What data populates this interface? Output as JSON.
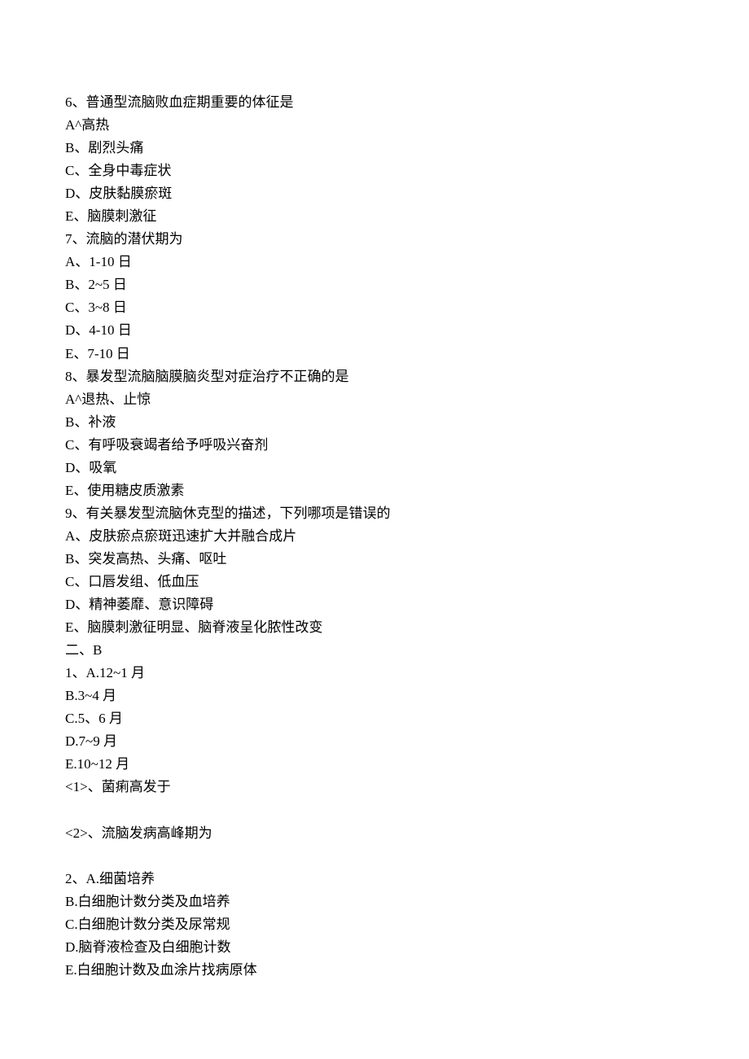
{
  "lines": [
    "6、普通型流脑败血症期重要的体征是",
    "A^高热",
    "B、剧烈头痛",
    "C、全身中毒症状",
    "D、皮肤黏膜瘀斑",
    "E、脑膜刺激征",
    "7、流脑的潜伏期为",
    "A、1-10 日",
    "B、2~5 日",
    "C、3~8 日",
    "D、4-10 日",
    "E、7-10 日",
    "8、暴发型流脑脑膜脑炎型对症治疗不正确的是",
    "A^退热、止惊",
    "B、补液",
    "C、有呼吸衰竭者给予呼吸兴奋剂",
    "D、吸氧",
    "E、使用糖皮质激素",
    "9、有关暴发型流脑休克型的描述，下列哪项是错误的",
    "A、皮肤瘀点瘀斑迅速扩大并融合成片",
    "B、突发高热、头痛、呕吐",
    "C、口唇发组、低血压",
    "D、精神萎靡、意识障碍",
    "E、脑膜刺激征明显、脑脊液呈化脓性改变",
    "二、B",
    "1、A.12~1 月",
    "B.3~4 月",
    "C.5、6 月",
    "D.7~9 月",
    "E.10~12 月",
    "<1>、菌痢高发于",
    "",
    "<2>、流脑发病高峰期为",
    "",
    "2、A.细菌培养",
    "B.白细胞计数分类及血培养",
    "C.白细胞计数分类及尿常规",
    "D.脑脊液检查及白细胞计数",
    "E.白细胞计数及血涂片找病原体"
  ]
}
